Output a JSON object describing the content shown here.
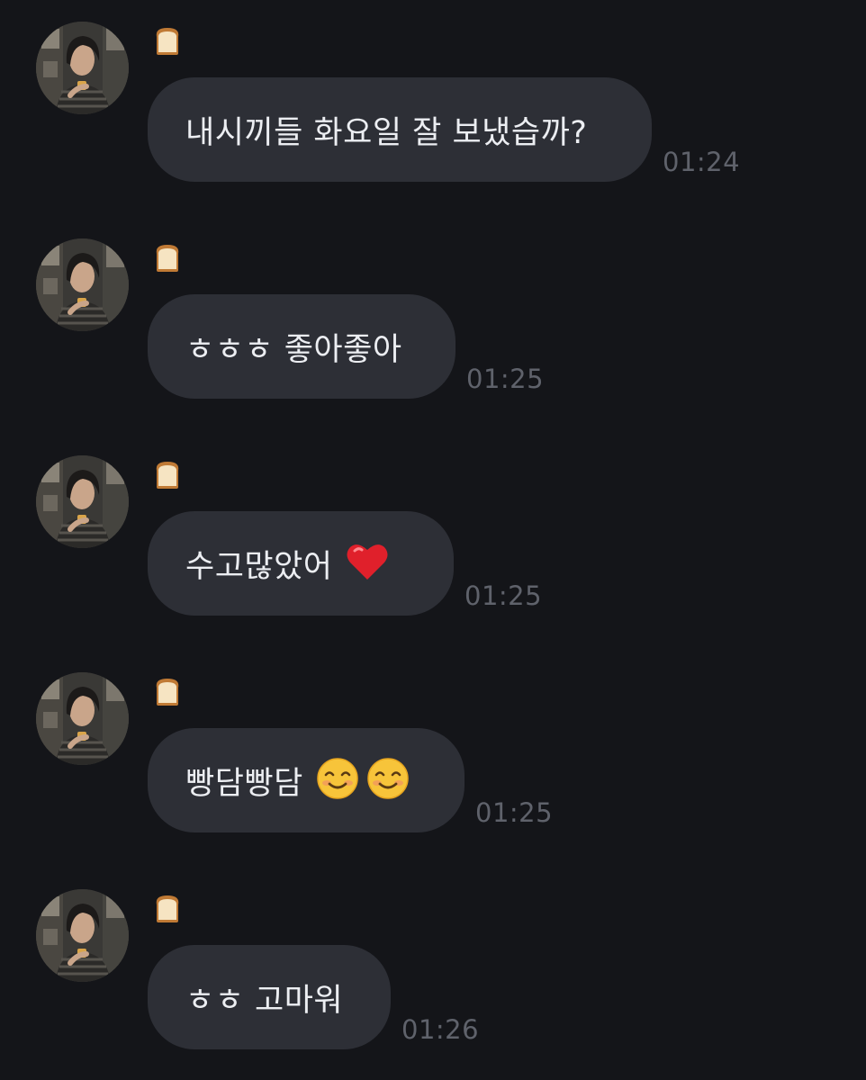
{
  "chat": {
    "messages": [
      {
        "text": "내시끼들 화요일 잘 보냈습까?",
        "time": "01:24"
      },
      {
        "text": "ㅎㅎㅎ 좋아좋아",
        "time": "01:25"
      },
      {
        "text": "수고많았어",
        "emoji": [
          "red-heart"
        ],
        "time": "01:25"
      },
      {
        "text": "빵담빵담",
        "emoji": [
          "smiling-face",
          "smiling-face"
        ],
        "time": "01:25"
      },
      {
        "text": "ㅎㅎ 고마워",
        "time": "01:26"
      }
    ],
    "sender_icon": "bread-emoji"
  },
  "colors": {
    "background": "#141519",
    "bubble": "#2d2f36",
    "text": "#eceef2",
    "timestamp": "#5f626b"
  }
}
